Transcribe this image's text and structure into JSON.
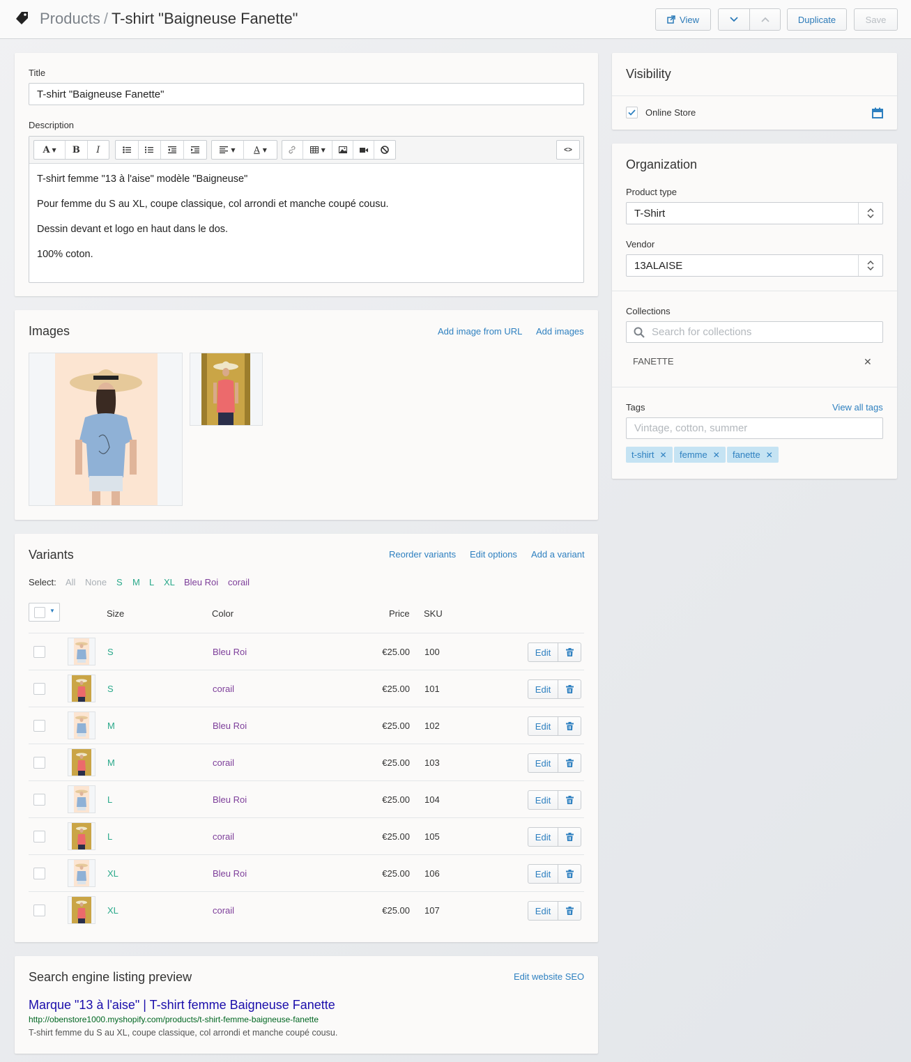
{
  "header": {
    "breadcrumb_parent": "Products",
    "breadcrumb_sep": "/",
    "title": "T-shirt \"Baigneuse Fanette\"",
    "view_label": "View",
    "duplicate_label": "Duplicate",
    "save_label": "Save"
  },
  "product": {
    "title_label": "Title",
    "title_value": "T-shirt \"Baigneuse Fanette\"",
    "description_label": "Description",
    "description": [
      "T-shirt femme \"13 à l'aise\" modèle \"Baigneuse\"",
      "Pour femme du S au XL, coupe classique, col arrondi et manche coupé cousu.",
      "Dessin devant et logo en haut dans le dos.",
      "100% coton."
    ],
    "toolbar_font_glyph": "A",
    "toolbar_bold": "B",
    "toolbar_italic": "I",
    "toolbar_text_color_glyph": "A",
    "toolbar_code": "<>"
  },
  "images": {
    "heading": "Images",
    "add_url_label": "Add image from URL",
    "add_images_label": "Add images"
  },
  "variants": {
    "heading": "Variants",
    "reorder_label": "Reorder variants",
    "edit_options_label": "Edit options",
    "add_variant_label": "Add a variant",
    "select_label": "Select:",
    "select_options": [
      "All",
      "None",
      "S",
      "M",
      "L",
      "XL",
      "Bleu Roi",
      "corail"
    ],
    "col_size": "Size",
    "col_color": "Color",
    "col_price": "Price",
    "col_sku": "SKU",
    "edit_label": "Edit",
    "rows": [
      {
        "size": "S",
        "color": "Bleu Roi",
        "price": "€25.00",
        "sku": "100"
      },
      {
        "size": "S",
        "color": "corail",
        "price": "€25.00",
        "sku": "101"
      },
      {
        "size": "M",
        "color": "Bleu Roi",
        "price": "€25.00",
        "sku": "102"
      },
      {
        "size": "M",
        "color": "corail",
        "price": "€25.00",
        "sku": "103"
      },
      {
        "size": "L",
        "color": "Bleu Roi",
        "price": "€25.00",
        "sku": "104"
      },
      {
        "size": "L",
        "color": "corail",
        "price": "€25.00",
        "sku": "105"
      },
      {
        "size": "XL",
        "color": "Bleu Roi",
        "price": "€25.00",
        "sku": "106"
      },
      {
        "size": "XL",
        "color": "corail",
        "price": "€25.00",
        "sku": "107"
      }
    ]
  },
  "seo": {
    "heading": "Search engine listing preview",
    "edit_label": "Edit website SEO",
    "page_title": "Marque \"13 à l'aise\" | T-shirt femme Baigneuse Fanette",
    "url": "http://obenstore1000.myshopify.com/products/t-shirt-femme-baigneuse-fanette",
    "description": "T-shirt femme du S au XL, coupe classique, col arrondi et manche coupé cousu."
  },
  "visibility": {
    "heading": "Visibility",
    "channel": "Online Store"
  },
  "organization": {
    "heading": "Organization",
    "product_type_label": "Product type",
    "product_type_value": "T-Shirt",
    "vendor_label": "Vendor",
    "vendor_value": "13ALAISE",
    "collections_label": "Collections",
    "collections_placeholder": "Search for collections",
    "collection_item": "FANETTE",
    "tags_label": "Tags",
    "view_all_tags": "View all tags",
    "tags_placeholder": "Vintage, cotton, summer",
    "tags": [
      "t-shirt",
      "femme",
      "fanette"
    ]
  },
  "colors": {
    "link": "#2e80c0",
    "size_option": "#2aa98b",
    "color_option": "#7d3e9a",
    "tag_bg": "#c5e3f3"
  }
}
